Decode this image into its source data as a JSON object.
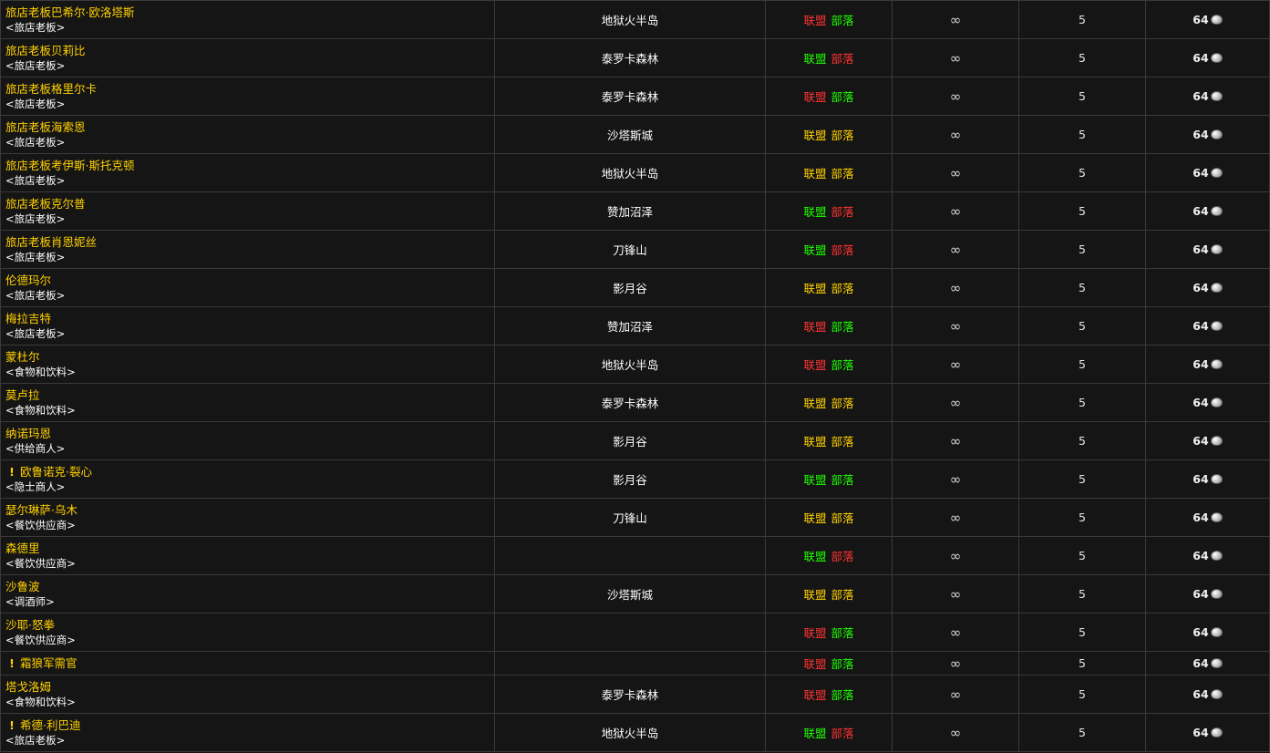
{
  "rows": [
    {
      "name": "旅店老板巴希尔·欧洛塔斯",
      "title": "<旅店老板>",
      "quest": false,
      "zone": "地狱火半岛",
      "alliance": "联盟",
      "alliance_color": "red",
      "horde": "部落",
      "horde_color": "green",
      "stock": "∞",
      "level": "5",
      "cost": "64"
    },
    {
      "name": "旅店老板贝莉比",
      "title": "<旅店老板>",
      "quest": false,
      "zone": "泰罗卡森林",
      "alliance": "联盟",
      "alliance_color": "green",
      "horde": "部落",
      "horde_color": "red",
      "stock": "∞",
      "level": "5",
      "cost": "64"
    },
    {
      "name": "旅店老板格里尔卡",
      "title": "<旅店老板>",
      "quest": false,
      "zone": "泰罗卡森林",
      "alliance": "联盟",
      "alliance_color": "red",
      "horde": "部落",
      "horde_color": "green",
      "stock": "∞",
      "level": "5",
      "cost": "64"
    },
    {
      "name": "旅店老板海索恩",
      "title": "<旅店老板>",
      "quest": false,
      "zone": "沙塔斯城",
      "alliance": "联盟",
      "alliance_color": "yellow",
      "horde": "部落",
      "horde_color": "yellow",
      "stock": "∞",
      "level": "5",
      "cost": "64"
    },
    {
      "name": "旅店老板考伊斯·斯托克顿",
      "title": "<旅店老板>",
      "quest": false,
      "zone": "地狱火半岛",
      "alliance": "联盟",
      "alliance_color": "yellow",
      "horde": "部落",
      "horde_color": "yellow",
      "stock": "∞",
      "level": "5",
      "cost": "64"
    },
    {
      "name": "旅店老板克尔普",
      "title": "<旅店老板>",
      "quest": false,
      "zone": "赞加沼泽",
      "alliance": "联盟",
      "alliance_color": "green",
      "horde": "部落",
      "horde_color": "red",
      "stock": "∞",
      "level": "5",
      "cost": "64"
    },
    {
      "name": "旅店老板肖恩妮丝",
      "title": "<旅店老板>",
      "quest": false,
      "zone": "刀锋山",
      "alliance": "联盟",
      "alliance_color": "green",
      "horde": "部落",
      "horde_color": "red",
      "stock": "∞",
      "level": "5",
      "cost": "64"
    },
    {
      "name": "伦德玛尔",
      "title": "<旅店老板>",
      "quest": false,
      "zone": "影月谷",
      "alliance": "联盟",
      "alliance_color": "yellow",
      "horde": "部落",
      "horde_color": "yellow",
      "stock": "∞",
      "level": "5",
      "cost": "64"
    },
    {
      "name": "梅拉吉特",
      "title": "<旅店老板>",
      "quest": false,
      "zone": "赞加沼泽",
      "alliance": "联盟",
      "alliance_color": "red",
      "horde": "部落",
      "horde_color": "green",
      "stock": "∞",
      "level": "5",
      "cost": "64"
    },
    {
      "name": "蒙杜尔",
      "title": "<食物和饮料>",
      "quest": false,
      "zone": "地狱火半岛",
      "alliance": "联盟",
      "alliance_color": "red",
      "horde": "部落",
      "horde_color": "green",
      "stock": "∞",
      "level": "5",
      "cost": "64"
    },
    {
      "name": "莫卢拉",
      "title": "<食物和饮料>",
      "quest": false,
      "zone": "泰罗卡森林",
      "alliance": "联盟",
      "alliance_color": "yellow",
      "horde": "部落",
      "horde_color": "yellow",
      "stock": "∞",
      "level": "5",
      "cost": "64"
    },
    {
      "name": "纳诺玛恩",
      "title": "<供给商人>",
      "quest": false,
      "zone": "影月谷",
      "alliance": "联盟",
      "alliance_color": "yellow",
      "horde": "部落",
      "horde_color": "yellow",
      "stock": "∞",
      "level": "5",
      "cost": "64"
    },
    {
      "name": "欧鲁诺克·裂心",
      "title": "<隐士商人>",
      "quest": true,
      "zone": "影月谷",
      "alliance": "联盟",
      "alliance_color": "green",
      "horde": "部落",
      "horde_color": "green",
      "stock": "∞",
      "level": "5",
      "cost": "64"
    },
    {
      "name": "瑟尔琳萨·乌木",
      "title": "<餐饮供应商>",
      "quest": false,
      "zone": "刀锋山",
      "alliance": "联盟",
      "alliance_color": "yellow",
      "horde": "部落",
      "horde_color": "yellow",
      "stock": "∞",
      "level": "5",
      "cost": "64"
    },
    {
      "name": "森德里",
      "title": "<餐饮供应商>",
      "quest": false,
      "zone": "",
      "alliance": "联盟",
      "alliance_color": "green",
      "horde": "部落",
      "horde_color": "red",
      "stock": "∞",
      "level": "5",
      "cost": "64"
    },
    {
      "name": "沙鲁波",
      "title": "<调酒师>",
      "quest": false,
      "zone": "沙塔斯城",
      "alliance": "联盟",
      "alliance_color": "yellow",
      "horde": "部落",
      "horde_color": "yellow",
      "stock": "∞",
      "level": "5",
      "cost": "64"
    },
    {
      "name": "沙耶·怒拳",
      "title": "<餐饮供应商>",
      "quest": false,
      "zone": "",
      "alliance": "联盟",
      "alliance_color": "red",
      "horde": "部落",
      "horde_color": "green",
      "stock": "∞",
      "level": "5",
      "cost": "64"
    },
    {
      "name": "霜狼军需官",
      "title": "",
      "quest": true,
      "zone": "",
      "alliance": "联盟",
      "alliance_color": "red",
      "horde": "部落",
      "horde_color": "green",
      "stock": "∞",
      "level": "5",
      "cost": "64"
    },
    {
      "name": "塔戈洛姆",
      "title": "<食物和饮料>",
      "quest": false,
      "zone": "泰罗卡森林",
      "alliance": "联盟",
      "alliance_color": "red",
      "horde": "部落",
      "horde_color": "green",
      "stock": "∞",
      "level": "5",
      "cost": "64"
    },
    {
      "name": "希德·利巴迪",
      "title": "<旅店老板>",
      "quest": true,
      "zone": "地狱火半岛",
      "alliance": "联盟",
      "alliance_color": "green",
      "horde": "部落",
      "horde_color": "red",
      "stock": "∞",
      "level": "5",
      "cost": "64"
    }
  ],
  "quest_icon": "exclamation-icon",
  "coin_icon": "silver-coin-icon",
  "colors": {
    "name": "#ffd100",
    "friendly": "#1eff00",
    "hostile": "#ff3232",
    "neutral": "#ffd100",
    "background": "#151515",
    "grid": "#3a3a3a"
  }
}
